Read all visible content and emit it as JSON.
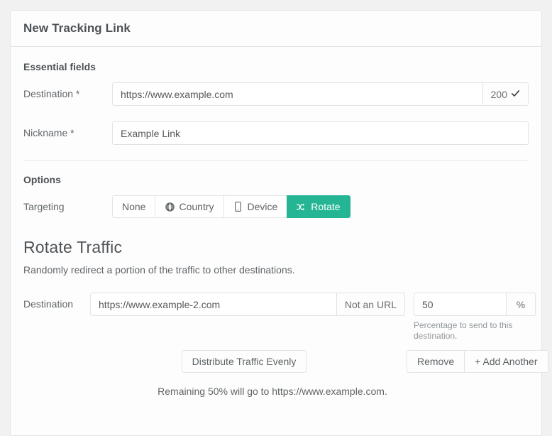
{
  "card": {
    "title": "New Tracking Link"
  },
  "essential": {
    "section_label": "Essential fields",
    "destination": {
      "label": "Destination *",
      "value": "https://www.example.com",
      "placeholder": "https://www.example.com",
      "status_code": "200",
      "status_icon": "check-icon"
    },
    "nickname": {
      "label": "Nickname *",
      "value": "Example Link",
      "placeholder": "Example Link"
    }
  },
  "options": {
    "section_label": "Options",
    "targeting": {
      "label": "Targeting",
      "active": "Rotate",
      "accent_color": "#24b694",
      "buttons": [
        {
          "label": "None",
          "icon": "",
          "active": false
        },
        {
          "label": "Country",
          "icon": "globe-icon",
          "active": false
        },
        {
          "label": "Device",
          "icon": "mobile-icon",
          "active": false
        },
        {
          "label": "Rotate",
          "icon": "shuffle-icon",
          "active": true
        }
      ]
    }
  },
  "rotate_traffic": {
    "title": "Rotate Traffic",
    "subtitle": "Randomly redirect a portion of the traffic to other destinations.",
    "destination": {
      "label": "Destination",
      "value": "https://www.example-2.com",
      "placeholder": "https://www.example-2.com",
      "addon_label": "Not an URL"
    },
    "percentage": {
      "value": "50",
      "placeholder": "50",
      "addon_label": "%",
      "help_text": "Percentage to send to this destination."
    },
    "distribute_button": "Distribute Traffic Evenly",
    "remove_button": "Remove",
    "add_button": "+ Add Another",
    "remaining_note": "Remaining 50% will go to https://www.example.com."
  }
}
